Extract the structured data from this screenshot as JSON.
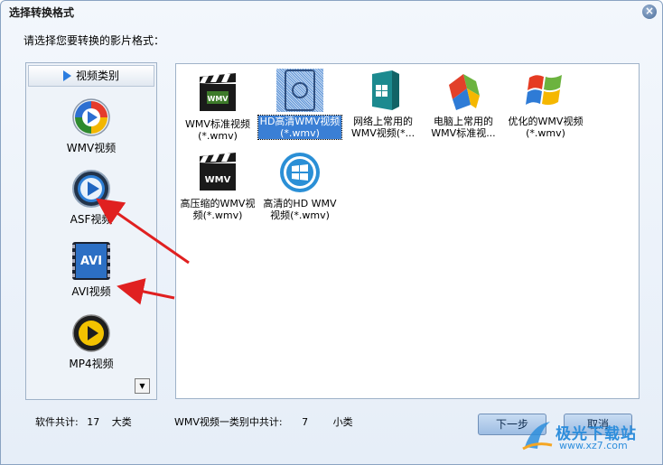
{
  "window": {
    "title": "选择转换格式"
  },
  "prompt": "请选择您要转换的影片格式：",
  "sidebar": {
    "header": "视频类别",
    "categories": [
      {
        "label": "WMV视频",
        "icon": "wmv-icon"
      },
      {
        "label": "ASF视频",
        "icon": "asf-icon"
      },
      {
        "label": "AVI视频",
        "icon": "avi-icon"
      },
      {
        "label": "MP4视频",
        "icon": "mp4-icon"
      }
    ]
  },
  "formats": [
    {
      "line1": "WMV标准视频",
      "line2": "(*.wmv)",
      "selected": false
    },
    {
      "line1": "HD高清WMV视频",
      "line2": "(*.wmv)",
      "selected": true
    },
    {
      "line1": "网络上常用的",
      "line2": "WMV视频(*...",
      "selected": false
    },
    {
      "line1": "电脑上常用的",
      "line2": "WMV标准视...",
      "selected": false
    },
    {
      "line1": "优化的WMV视频",
      "line2": "(*.wmv)",
      "selected": false
    },
    {
      "line1": "高压缩的WMV视",
      "line2": "频(*.wmv)",
      "selected": false
    },
    {
      "line1": "高清的HD WMV",
      "line2": "视频(*.wmv)",
      "selected": false
    }
  ],
  "footer": {
    "software_total_label": "软件共计:",
    "software_total_value": "17",
    "software_total_unit": "大类",
    "category_total_label": "WMV视频一类别中共计:",
    "category_total_value": "7",
    "category_total_unit": "小类"
  },
  "buttons": {
    "next": "下一步",
    "cancel": "取消"
  },
  "watermark": {
    "text": "极光下载站",
    "url": "www.xz7.com"
  },
  "colors": {
    "accent": "#3a7fd5",
    "arrow": "#e02020",
    "watermark": "#2e8edc"
  }
}
